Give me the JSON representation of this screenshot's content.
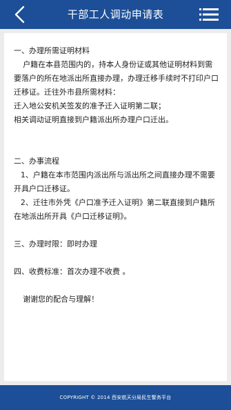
{
  "header": {
    "title": "干部工人调动申请表",
    "back_icon": "chevron-left-icon",
    "menu_icon": "hamburger-menu-icon",
    "bg_color": "#1c4f97"
  },
  "content": {
    "materials_title": "一、办理所需证明材料",
    "materials_para": "户籍在本县范围内的，持本人身份证或其他证明材料到需要落户的所在地派出所直接办理，办理迁移手续时不打印户口迁移证。迁往外市县所需材料：",
    "materials_item1": "迁入地公安机关签发的准予迁入证明第二联；",
    "materials_item2": "相关调动证明直接到户籍派出所办理户口迁出。",
    "process_title": "二、办事流程",
    "process_item1": "1、户籍在本市范围内派出所与派出所之间直接办理不需要开具户口迁移证。",
    "process_item2": "2、迁往市外凭《户口准予迁入证明》第二联直接到户籍所在地派出所开具《户口迁移证明》。",
    "time_title": "三、办理时限：即时办理",
    "fee_title": "四、收费标准：首次办理不收费 。",
    "thanks": "谢谢您的配合与理解！"
  },
  "footer": {
    "copyright": "COPYRIGHT © 2014 西安航天分局民生警务平台"
  }
}
